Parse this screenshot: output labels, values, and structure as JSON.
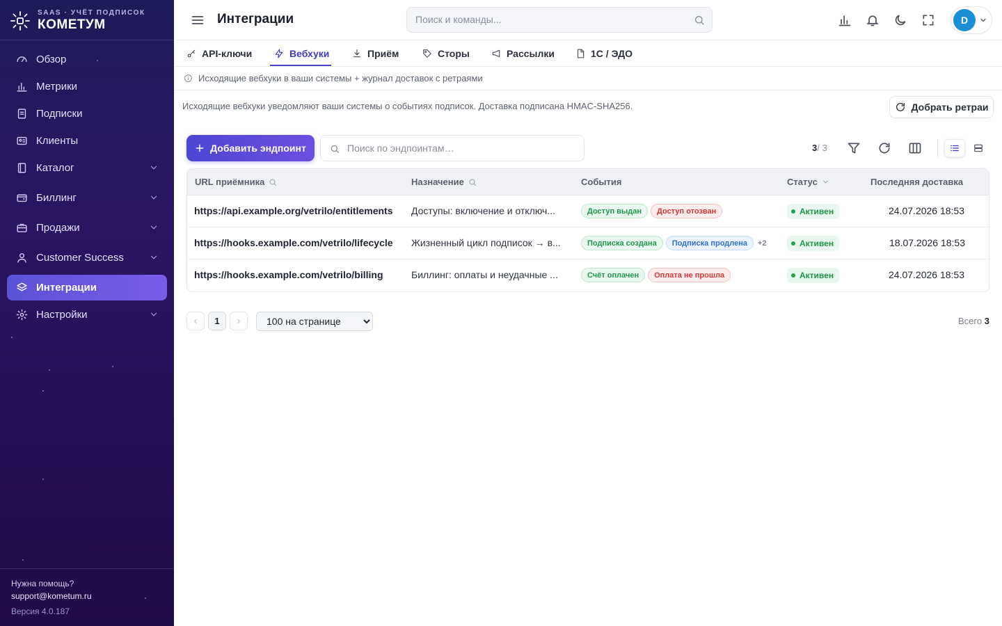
{
  "brand": {
    "subtitle": "SAAS · УЧЁТ ПОДПИСОК",
    "name": "КОМЕТУМ"
  },
  "sidebar": {
    "items": [
      {
        "label": "Обзор",
        "icon": "gauge-icon",
        "expandable": false
      },
      {
        "label": "Метрики",
        "icon": "bar-chart-icon",
        "expandable": false
      },
      {
        "label": "Подписки",
        "icon": "clipboard-icon",
        "expandable": false
      },
      {
        "label": "Клиенты",
        "icon": "id-card-icon",
        "expandable": false
      },
      {
        "label": "Каталог",
        "icon": "book-icon",
        "expandable": true
      },
      {
        "label": "Биллинг",
        "icon": "wallet-icon",
        "expandable": true
      },
      {
        "label": "Продажи",
        "icon": "briefcase-icon",
        "expandable": true
      },
      {
        "label": "Customer Success",
        "icon": "user-icon",
        "expandable": true
      },
      {
        "label": "Интеграции",
        "icon": "layers-icon",
        "expandable": false,
        "active": true
      },
      {
        "label": "Настройки",
        "icon": "gear-icon",
        "expandable": true
      }
    ],
    "help_label": "Нужна помощь?",
    "help_email": "support@kometum.ru",
    "version": "Версия 4.0.187"
  },
  "header": {
    "title": "Интеграции",
    "search_placeholder": "Поиск и команды...",
    "avatar_letter": "D"
  },
  "tabs": [
    {
      "label": "API-ключи",
      "icon": "key-icon"
    },
    {
      "label": "Вебхуки",
      "icon": "bolt-icon",
      "active": true
    },
    {
      "label": "Приём",
      "icon": "download-icon"
    },
    {
      "label": "Сторы",
      "icon": "tag-icon"
    },
    {
      "label": "Рассылки",
      "icon": "megaphone-icon"
    },
    {
      "label": "1С / ЭДО",
      "icon": "file-icon"
    }
  ],
  "info_text": "Исходящие вебхуки в ваши системы + журнал доставок с ретраями",
  "description": "Исходящие вебхуки уведомляют ваши системы о событиях подписок. Доставка подписана HMAC-SHA256.",
  "retry_button": "Добрать ретраи",
  "toolbar": {
    "add_label": "Добавить эндпоинт",
    "search_placeholder": "Поиск по эндпоинтам…",
    "count_shown": "3",
    "count_total": "/ 3"
  },
  "table": {
    "columns": {
      "url": "URL приёмника",
      "purpose": "Назначение",
      "events": "События",
      "status": "Статус",
      "last": "Последняя доставка"
    },
    "rows": [
      {
        "url": "https://api.example.org/vetrilo/entitlements",
        "purpose": "Доступы: включение и отключ...",
        "events": [
          {
            "label": "Доступ выдан",
            "tone": "green"
          },
          {
            "label": "Доступ отозван",
            "tone": "red"
          }
        ],
        "more": "",
        "status": "Активен",
        "last": "24.07.2026 18:53"
      },
      {
        "url": "https://hooks.example.com/vetrilo/lifecycle",
        "purpose": "Жизненный цикл подписок → в...",
        "events": [
          {
            "label": "Подписка создана",
            "tone": "green"
          },
          {
            "label": "Подписка продлена",
            "tone": "blue"
          }
        ],
        "more": "+2",
        "status": "Активен",
        "last": "18.07.2026 18:53"
      },
      {
        "url": "https://hooks.example.com/vetrilo/billing",
        "purpose": "Биллинг: оплаты и неудачные ...",
        "events": [
          {
            "label": "Счёт оплачен",
            "tone": "green"
          },
          {
            "label": "Оплата не прошла",
            "tone": "red"
          }
        ],
        "more": "",
        "status": "Активен",
        "last": "24.07.2026 18:53"
      }
    ]
  },
  "pagination": {
    "current_page": "1",
    "per_page": "100 на странице",
    "per_page_options": [
      "100 на странице"
    ],
    "total_label": "Всего",
    "total_value": "3"
  }
}
